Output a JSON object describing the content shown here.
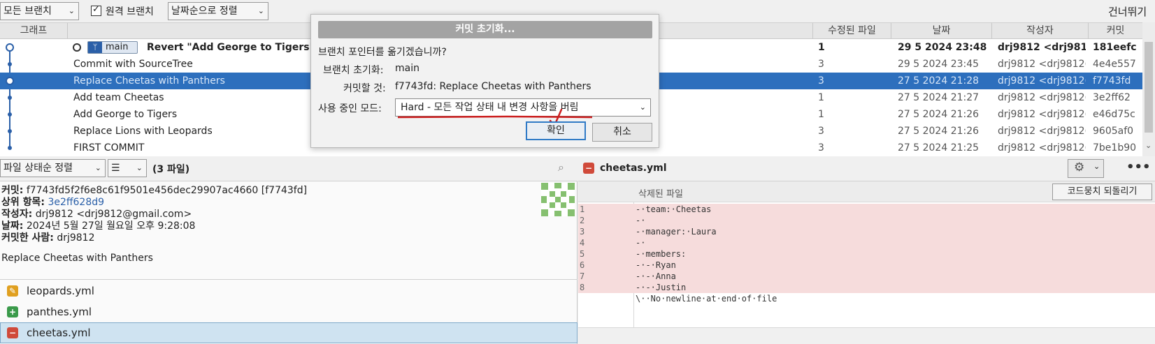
{
  "toolbar": {
    "branch_filter": "모든 브랜치",
    "remote_branches_label": "원격 브랜치",
    "remote_branches_checked": true,
    "sort_order": "날짜순으로 정렬",
    "skip_label": "건너뛰기"
  },
  "columns": {
    "graph": "그래프",
    "description": "",
    "modified_files": "수정된 파일",
    "date": "날짜",
    "author": "작성자",
    "commit": "커밋"
  },
  "commits": [
    {
      "message": "Revert \"Add George to Tigers\"",
      "branch": "main",
      "files": "1",
      "date": "29 5 2024 23:48",
      "author": "drj9812 <drj9812",
      "hash": "181eefc"
    },
    {
      "message": "Commit with SourceTree",
      "files": "3",
      "date": "29 5 2024 23:45",
      "author": "drj9812 <drj9812(",
      "hash": "4e4e557"
    },
    {
      "message": "Replace Cheetas with Panthers",
      "files": "3",
      "date": "27 5 2024 21:28",
      "author": "drj9812 <drj9812(",
      "hash": "f7743fd"
    },
    {
      "message": "Add team Cheetas",
      "files": "1",
      "date": "27 5 2024 21:27",
      "author": "drj9812 <drj9812(",
      "hash": "3e2ff62"
    },
    {
      "message": "Add George to Tigers",
      "files": "1",
      "date": "27 5 2024 21:26",
      "author": "drj9812 <drj9812(",
      "hash": "e46d75c"
    },
    {
      "message": "Replace Lions with Leopards",
      "files": "3",
      "date": "27 5 2024 21:26",
      "author": "drj9812 <drj9812(",
      "hash": "9605af0"
    },
    {
      "message": "FIRST COMMIT",
      "files": "3",
      "date": "27 5 2024 21:25",
      "author": "drj9812 <drj9812(",
      "hash": "7be1b90"
    }
  ],
  "file_panel": {
    "sort_label": "파일 상태순 정렬",
    "count_label": "(3 파일)"
  },
  "details": {
    "commit_label": "커밋:",
    "commit_value": "f7743fd5f2f6e8c61f9501e456dec29907ac4660 [f7743fd]",
    "parent_label": "상위 항목:",
    "parent_value": "3e2ff628d9",
    "author_label": "작성자:",
    "author_value": "drj9812 <drj9812@gmail.com>",
    "date_label": "날짜:",
    "date_value": "2024년 5월 27일 월요일 오후 9:28:08",
    "committer_label": "커밋한 사람:",
    "committer_value": "drj9812",
    "message": "Replace Cheetas with Panthers"
  },
  "files": [
    {
      "name": "leopards.yml",
      "status": "modified",
      "glyph": "✎",
      "color": "#e0a020"
    },
    {
      "name": "panthes.yml",
      "status": "added",
      "glyph": "+",
      "color": "#3a9a4a"
    },
    {
      "name": "cheetas.yml",
      "status": "removed",
      "glyph": "−",
      "color": "#d04a3a"
    }
  ],
  "diff": {
    "filename": "cheetas.yml",
    "header": "삭제된 파일",
    "revert_hunk_label": "코드뭉치 되돌리기",
    "lines": [
      {
        "n": "1",
        "text": "-·team:·Cheetas"
      },
      {
        "n": "2",
        "text": "-·"
      },
      {
        "n": "3",
        "text": "-·manager:·Laura"
      },
      {
        "n": "4",
        "text": "-·"
      },
      {
        "n": "5",
        "text": "-·members:"
      },
      {
        "n": "6",
        "text": "-·-·Ryan"
      },
      {
        "n": "7",
        "text": "-·-·Anna"
      },
      {
        "n": "8",
        "text": "-·-·Justin"
      }
    ],
    "no_newline": "\\··No·newline·at·end·of·file"
  },
  "dialog": {
    "title": "커밋 초기화...",
    "question": "브랜치 포인터를 옮기겠습니까?",
    "reset_branch_label": "브랜치 초기화:",
    "reset_branch_value": "main",
    "target_commit_label": "커밋할 것:",
    "target_commit_value": "f7743fd: Replace Cheetas with Panthers",
    "mode_label": "사용 중인 모드:",
    "mode_value": "Hard - 모든 작업 상태 내 변경 사항을 버림",
    "ok_label": "확인",
    "cancel_label": "취소"
  },
  "colors": {
    "selection": "#2d6fbd",
    "graph": "#2a5fa8",
    "deleted_line": "#f6dcdc",
    "annotation": "#cc1f1f"
  }
}
